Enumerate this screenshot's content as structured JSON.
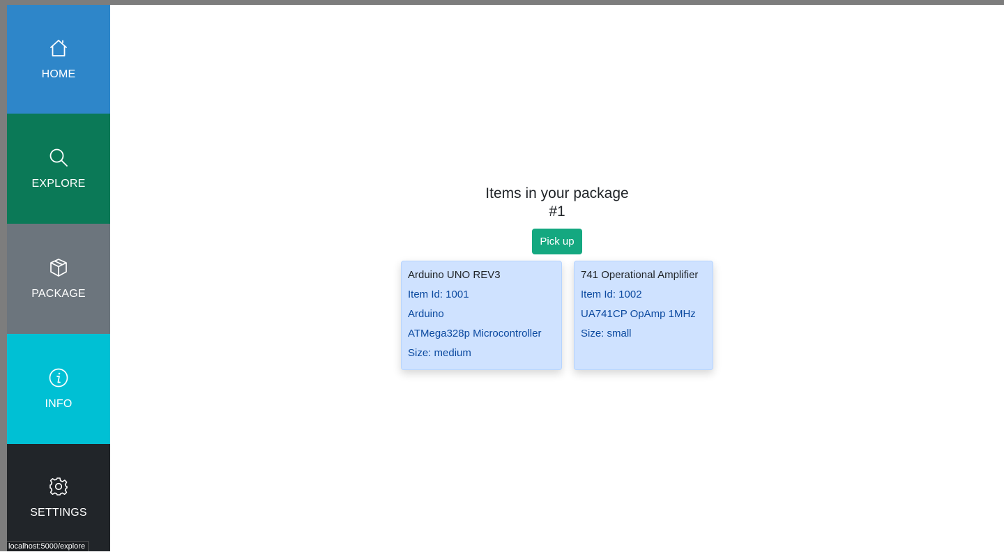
{
  "sidebar": {
    "items": [
      {
        "label": "HOME",
        "icon": "home-icon",
        "color": "#2e86c9"
      },
      {
        "label": "EXPLORE",
        "icon": "search-icon",
        "color": "#0b7957"
      },
      {
        "label": "PACKAGE",
        "icon": "box-icon",
        "color": "#6c757d"
      },
      {
        "label": "INFO",
        "icon": "info-icon",
        "color": "#00c0d4"
      },
      {
        "label": "SETTINGS",
        "icon": "gear-icon",
        "color": "#212529"
      }
    ]
  },
  "status_bar": {
    "url": "localhost:5000/explore"
  },
  "main": {
    "title_line1": "Items in your package",
    "title_line2": "#1",
    "pickup_label": "Pick up",
    "items": [
      {
        "name": "Arduino UNO REV3",
        "item_id": "Item Id: 1001",
        "brand": "Arduino",
        "description": "ATMega328p Microcontroller",
        "size": "Size: medium"
      },
      {
        "name": "741 Operational Amplifier",
        "item_id": "Item Id: 1002",
        "description": "UA741CP OpAmp 1MHz",
        "size": "Size: small"
      }
    ]
  },
  "colors": {
    "pickup_button": "#14a880",
    "card_background": "#cfe2ff",
    "card_text": "#0c4aa0"
  }
}
